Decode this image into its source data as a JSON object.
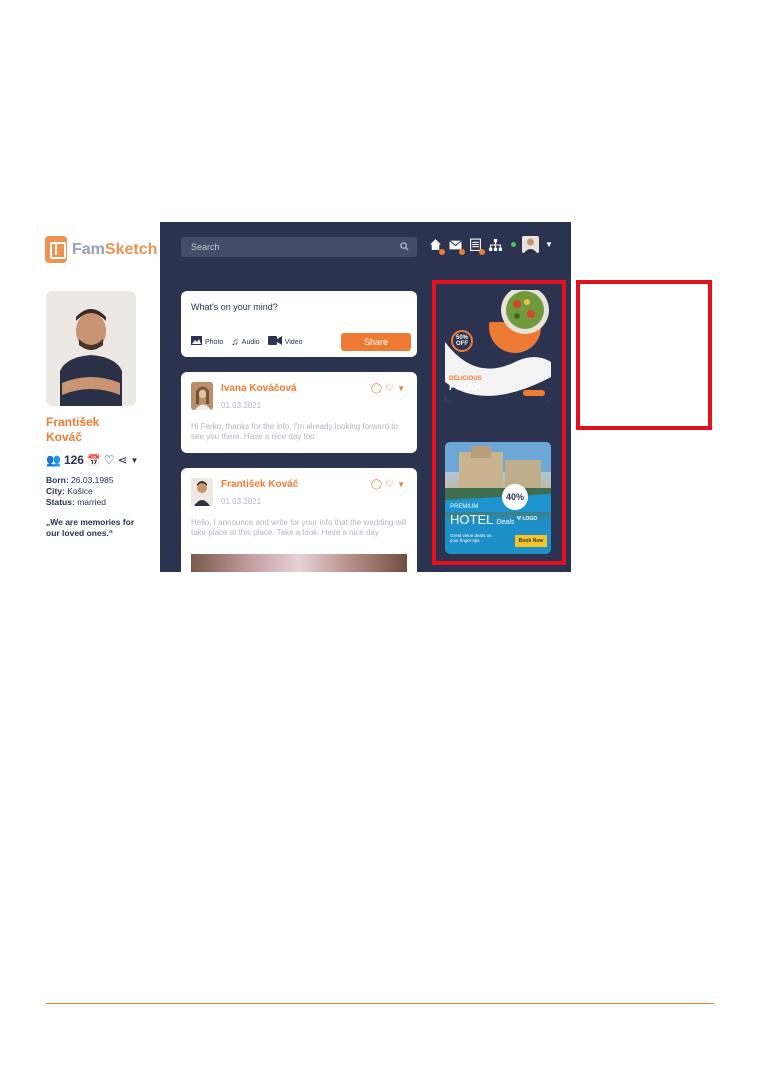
{
  "brand": {
    "part1": "Fam",
    "part2": "Sketch"
  },
  "profile": {
    "name_line1": "František",
    "name_line2": "Kováč",
    "friends_count": "126",
    "born_label": "Born:",
    "born_value": "26.03.1985",
    "city_label": "City:",
    "city_value": "Košice",
    "status_label": "Status:",
    "status_value": "married",
    "quote": "„We are memories for our loved ones.“"
  },
  "header": {
    "search_placeholder": "Search",
    "icons": [
      "home-icon",
      "mail-icon",
      "calendar-icon",
      "family-tree-icon"
    ]
  },
  "composer": {
    "prompt": "What's on your mind?",
    "photo_label": "Photo",
    "audio_label": "Audio",
    "video_label": "Video",
    "share_label": "Share"
  },
  "posts": [
    {
      "author": "Ivana Kováčová",
      "date": "01.03.2021",
      "text": "Hi Ferko, thanks for the info, I'm already looking forward to see you there. Have a nice day too"
    },
    {
      "author": "František Kováč",
      "date": "01.03.2021",
      "text": "Hello, I announce and write for your info that the wedding will take place at this place. Take a look. Have a nice day"
    }
  ],
  "ads": {
    "food": {
      "discount": "50%",
      "off": "OFF",
      "line1": "DELICIOUS",
      "line2": "FOOD!"
    },
    "hotel": {
      "premium": "PREMIUM",
      "word": "HOTEL",
      "deals": "Deals",
      "subtitle": "Great value deals on your finger tips",
      "discount": "40%",
      "logo": "LOGO",
      "cta": "Book Now"
    }
  },
  "colors": {
    "accent": "#ee7b34",
    "app_bg": "#2c3350",
    "highlight": "#e4101e"
  }
}
